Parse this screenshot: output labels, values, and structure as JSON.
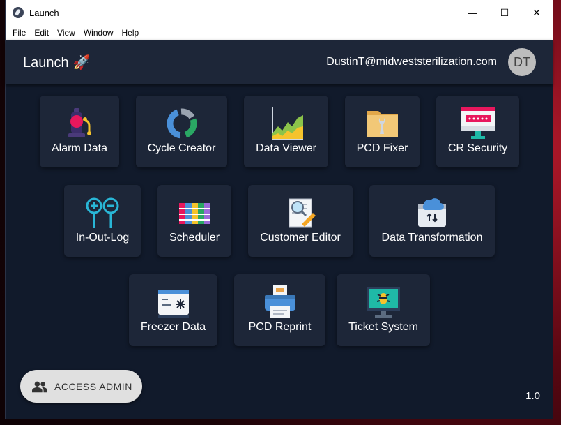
{
  "window": {
    "title": "Launch",
    "controls": {
      "minimize": "—",
      "maximize": "☐",
      "close": "✕"
    }
  },
  "menu": [
    "File",
    "Edit",
    "View",
    "Window",
    "Help"
  ],
  "header": {
    "brand": "Launch",
    "brand_icon": "🚀",
    "user_email": "DustinT@midweststerilization.com",
    "avatar_initials": "DT"
  },
  "tiles": [
    {
      "label": "Alarm Data",
      "icon": "alarm-light-icon"
    },
    {
      "label": "Cycle Creator",
      "icon": "cycle-ring-icon"
    },
    {
      "label": "Data Viewer",
      "icon": "area-chart-icon"
    },
    {
      "label": "PCD Fixer",
      "icon": "wrench-folder-icon"
    },
    {
      "label": "CR Security",
      "icon": "password-monitor-icon"
    },
    {
      "label": "In-Out-Log",
      "icon": "plus-minus-pins-icon"
    },
    {
      "label": "Scheduler",
      "icon": "schedule-grid-icon"
    },
    {
      "label": "Customer Editor",
      "icon": "document-magnifier-icon"
    },
    {
      "label": "Data Transformation",
      "icon": "cloud-transfer-icon"
    },
    {
      "label": "Freezer Data",
      "icon": "freezer-icon"
    },
    {
      "label": "PCD Reprint",
      "icon": "printer-icon"
    },
    {
      "label": "Ticket System",
      "icon": "bug-monitor-icon"
    }
  ],
  "admin_button": {
    "label": "ACCESS ADMIN",
    "icon": "people-icon"
  },
  "version": "1.0"
}
